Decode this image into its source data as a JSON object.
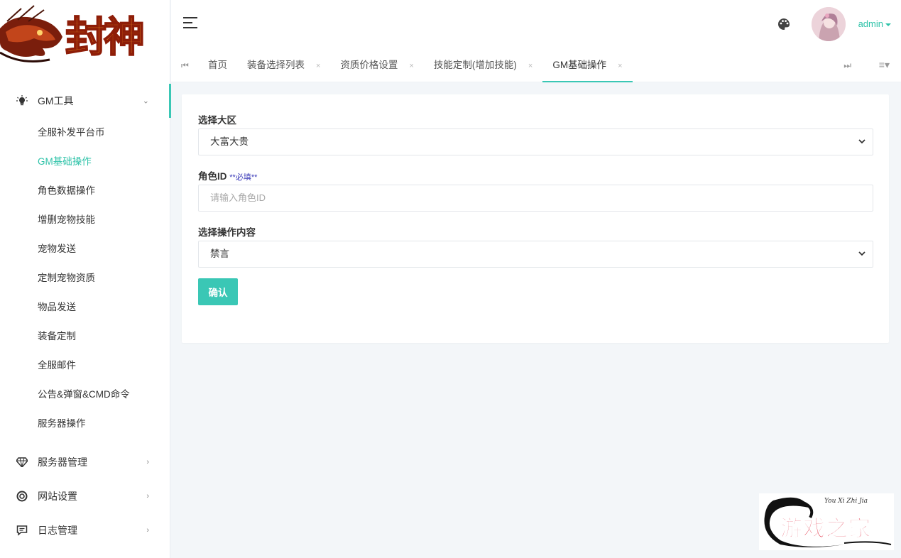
{
  "logo": {
    "text": "封神"
  },
  "sidebar": {
    "groups": [
      {
        "label": "GM工具",
        "icon": "lightbulb-icon",
        "expanded": true
      },
      {
        "label": "服务器管理",
        "icon": "diamond-icon"
      },
      {
        "label": "网站设置",
        "icon": "settings-circle-icon"
      },
      {
        "label": "日志管理",
        "icon": "log-icon"
      }
    ],
    "subitems": [
      "全服补发平台币",
      "GM基础操作",
      "角色数据操作",
      "增删宠物技能",
      "宠物发送",
      "定制宠物资质",
      "物品发送",
      "装备定制",
      "全服邮件",
      "公告&弹窗&CMD命令",
      "服务器操作"
    ],
    "current_index": 1
  },
  "header": {
    "username": "admin",
    "icons": [
      "hamburger-icon",
      "palette-icon",
      "avatar"
    ]
  },
  "tabs": [
    {
      "label": "首页",
      "closable": false
    },
    {
      "label": "装备选择列表",
      "closable": true
    },
    {
      "label": "资质价格设置",
      "closable": true
    },
    {
      "label": "技能定制(增加技能)",
      "closable": true
    },
    {
      "label": "GM基础操作",
      "closable": true,
      "active": true
    }
  ],
  "tab_close_symbol": "×",
  "form": {
    "region": {
      "label": "选择大区",
      "value": "大富大贵"
    },
    "role_id": {
      "label": "角色ID",
      "required_note": "**必填**",
      "placeholder": "请输入角色ID"
    },
    "operation": {
      "label": "选择操作内容",
      "value": "禁言"
    },
    "confirm_label": "确认"
  },
  "watermark": {
    "text": "游戏之家",
    "pinyin": "You Xi Zhi Jia"
  },
  "colors": {
    "accent": "#3ac7b5",
    "active_text": "#2fc3a9",
    "background": "#f3f6f9"
  }
}
